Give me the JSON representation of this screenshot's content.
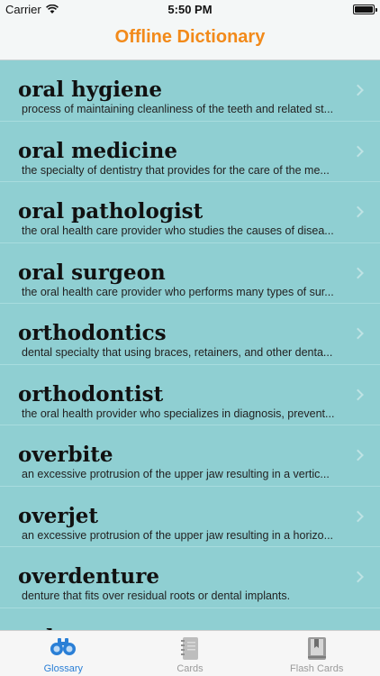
{
  "status": {
    "carrier": "Carrier",
    "time": "5:50 PM"
  },
  "nav": {
    "title": "Offline Dictionary"
  },
  "entries": [
    {
      "term": "oral hygiene",
      "definition": "process of maintaining cleanliness of the teeth and related st..."
    },
    {
      "term": "oral medicine",
      "definition": "the specialty of dentistry that provides for the care of the me..."
    },
    {
      "term": "oral pathologist",
      "definition": "the oral health care provider who studies the causes of disea..."
    },
    {
      "term": "oral surgeon",
      "definition": "the oral health care provider who performs many types of sur..."
    },
    {
      "term": "orthodontics",
      "definition": "dental specialty that using braces, retainers, and other denta..."
    },
    {
      "term": "orthodontist",
      "definition": "the oral health provider who specializes in diagnosis, prevent..."
    },
    {
      "term": "overbite",
      "definition": "an excessive protrusion of the upper jaw resulting in a vertic..."
    },
    {
      "term": "overjet",
      "definition": "an excessive protrusion of the upper jaw resulting in a horizo..."
    },
    {
      "term": "overdenture",
      "definition": "denture that fits over residual roots or dental implants."
    },
    {
      "term": "palate",
      "definition": ""
    }
  ],
  "tabs": [
    {
      "label": "Glossary",
      "icon": "binoculars-icon",
      "active": true
    },
    {
      "label": "Cards",
      "icon": "notebook-icon",
      "active": false
    },
    {
      "label": "Flash Cards",
      "icon": "book-icon",
      "active": false
    }
  ],
  "colors": {
    "list_background": "#8fcfd2",
    "title_accent": "#f28a1a",
    "tab_active": "#2a7fd6"
  }
}
